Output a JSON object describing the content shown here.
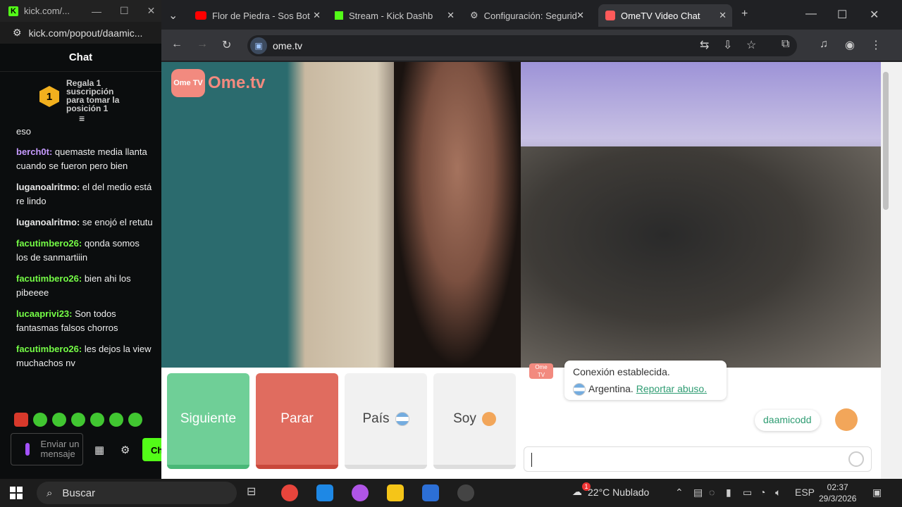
{
  "kick": {
    "tab_title": "kick.com/...",
    "url": "kick.com/popout/daamic...",
    "chat_title": "Chat",
    "pinned": {
      "rank": "1",
      "text_lines": [
        "Regala 1",
        "suscripción",
        "para tomar la",
        "posición 1"
      ]
    },
    "first_line": "eso",
    "messages": [
      {
        "user": "berch0t:",
        "text": "quemaste media llanta cuando se fueron pero bien",
        "color": "#c79bff"
      },
      {
        "user": "luganoalritmo:",
        "text": "el del medio está re lindo",
        "color": "#e6e6e6"
      },
      {
        "user": "luganoalritmo:",
        "text": "se enojó el retutu",
        "color": "#e6e6e6"
      },
      {
        "user": "facutimbero26:",
        "text": "qonda somos los de sanmartiiin",
        "color": "#75fd46"
      },
      {
        "user": "facutimbero26:",
        "text": "bien ahi los pibeeee",
        "color": "#75fd46"
      },
      {
        "user": "lucaaprivi23:",
        "text": "Son todos fantasmas falsos chorros",
        "color": "#75fd46"
      },
      {
        "user": "facutimbero26:",
        "text": "les dejos la view muchachos nv",
        "color": "#75fd46"
      }
    ],
    "input_placeholder": "Enviar un mensaje",
    "chat_button": "Ch"
  },
  "chrome": {
    "tabs": [
      {
        "title": "Flor de Piedra - Sos Bot",
        "icon": "youtube-icon"
      },
      {
        "title": "Stream - Kick Dashb",
        "icon": "kick-icon"
      },
      {
        "title": "Configuración: Segurid",
        "icon": "gear-icon"
      },
      {
        "title": "OmeTV Video Chat",
        "icon": "ometv-icon"
      }
    ],
    "url": "ome.tv"
  },
  "ometv": {
    "logo_box": "Ome TV",
    "logo_text": "Ome.tv",
    "buttons": {
      "next": "Siguiente",
      "stop": "Parar",
      "country": "País",
      "me": "Soy"
    },
    "system_message": {
      "line1": "Conexión establecida.",
      "country": "Argentina.",
      "report": "Reportar abuso."
    },
    "my_message": "daamicodd"
  },
  "taskbar": {
    "search": "Buscar",
    "weather": "22°C  Nublado",
    "weather_badge": "1",
    "lang": "ESP",
    "time": "02:37",
    "date": "29/3/2026"
  }
}
